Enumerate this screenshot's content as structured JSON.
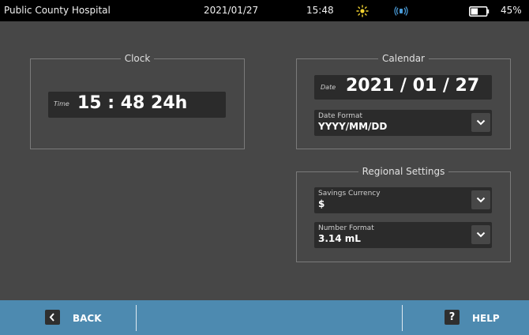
{
  "status_bar": {
    "hospital": "Public County Hospital",
    "date": "2021/01/27",
    "time": "15:48",
    "battery_percent": "45%",
    "battery_level": 0.45,
    "accent_color": "#f2d230"
  },
  "clock": {
    "title": "Clock",
    "time_tag": "Time",
    "time_value": "15 : 48  24h"
  },
  "calendar": {
    "title": "Calendar",
    "date_tag": "Date",
    "date_value": "2021 / 01 / 27",
    "format_label": "Date Format",
    "format_value": "YYYY/MM/DD"
  },
  "regional": {
    "title": "Regional Settings",
    "currency_label": "Savings Currency",
    "currency_value": "$",
    "number_label": "Number Format",
    "number_value": "3.14 mL"
  },
  "footer": {
    "back_label": "BACK",
    "help_label": "HELP",
    "help_icon": "?",
    "bar_color": "#4d8ab0"
  }
}
